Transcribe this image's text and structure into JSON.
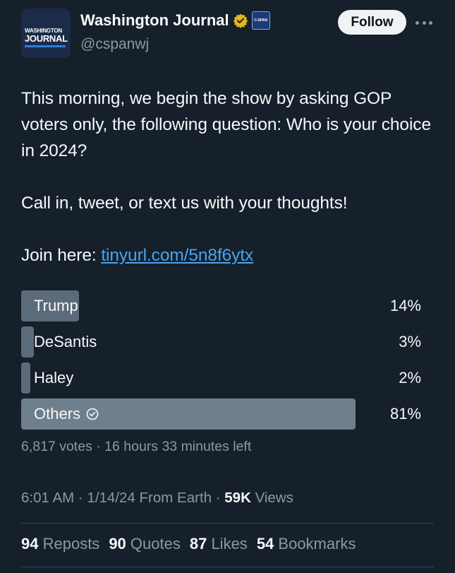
{
  "author": {
    "avatar_line1": "WASHINGTON",
    "avatar_line2": "JOURNAL",
    "name": "Washington Journal",
    "badge_text": "C-SPAN",
    "handle": "@cspanwj"
  },
  "actions": {
    "follow_label": "Follow"
  },
  "tweet": {
    "line1": "This morning, we begin the show by asking GOP voters only, the following question: Who is your choice in 2024?",
    "line2": "Call in, tweet, or text us with your thoughts!",
    "join_prefix": "Join here: ",
    "link_text": "tinyurl.com/5n8f6ytx"
  },
  "poll": {
    "options": [
      {
        "label": "Trump",
        "percent_text": "14%",
        "percent": 14
      },
      {
        "label": "DeSantis",
        "percent_text": "3%",
        "percent": 3
      },
      {
        "label": "Haley",
        "percent_text": "2%",
        "percent": 2
      },
      {
        "label": "Others",
        "percent_text": "81%",
        "percent": 81
      }
    ],
    "meta": "6,817 votes · 16 hours 33 minutes left"
  },
  "timestamp": {
    "time": "6:01 AM · 1/14/24 From Earth · ",
    "views_count": "59K",
    "views_label": " Views"
  },
  "stats": {
    "reposts_count": "94",
    "reposts_label": " Reposts",
    "quotes_count": "90",
    "quotes_label": " Quotes",
    "likes_count": "87",
    "likes_label": " Likes",
    "bookmarks_count": "54",
    "bookmarks_label": " Bookmarks"
  },
  "colors": {
    "background": "#15202b",
    "link": "#4aa3f0",
    "verified_gold": "#e2b719",
    "bar": "#5c6b79"
  }
}
